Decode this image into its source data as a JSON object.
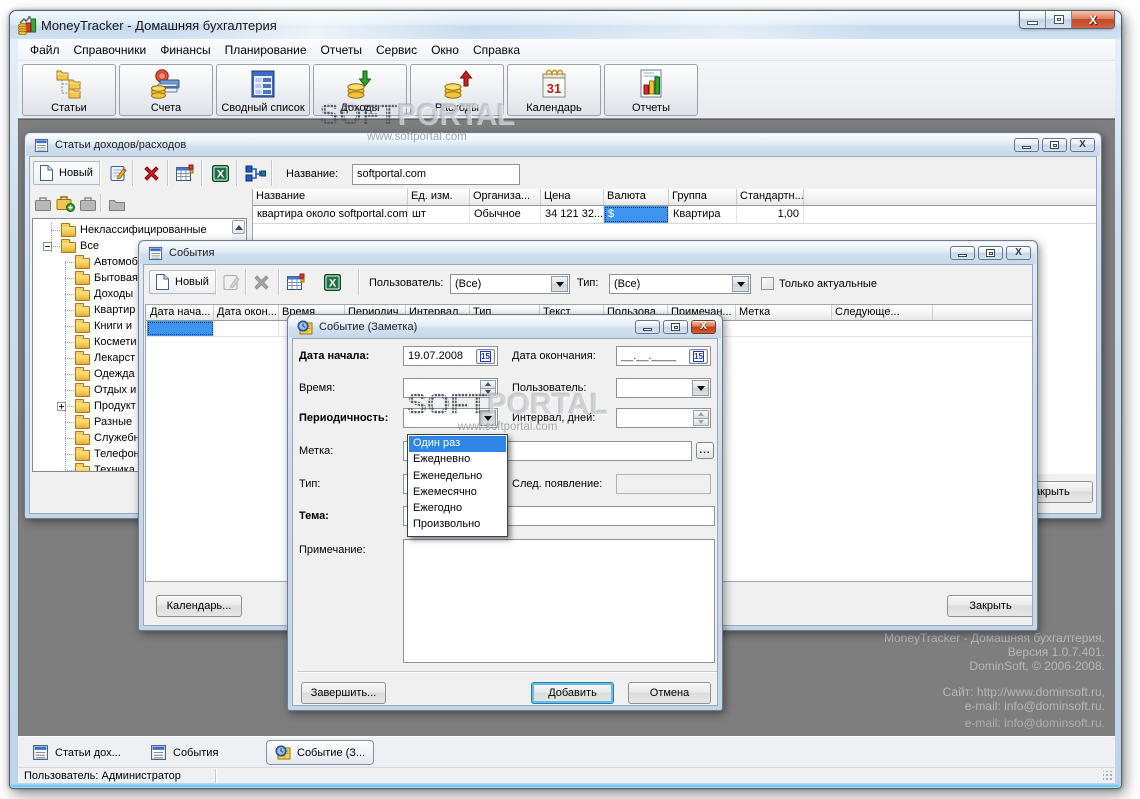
{
  "main_window": {
    "title": "MoneyTracker - Домашняя бухгалтерия",
    "menu_items": [
      "Файл",
      "Справочники",
      "Финансы",
      "Планирование",
      "Отчеты",
      "Сервис",
      "Окно",
      "Справка"
    ],
    "toolbar_buttons": [
      "Статьи",
      "Счета",
      "Сводный список",
      "Доходы",
      "Расходы",
      "Календарь",
      "Отчеты"
    ],
    "taskbar_tabs": [
      "Статьи дох...",
      "События",
      "Событие (З..."
    ],
    "status_user": "Пользователь: Администратор"
  },
  "watermark": {
    "soft": "SOFT",
    "portal": "PORTAL",
    "url": "www.softportal.com"
  },
  "about_text": {
    "line1": "MoneyTracker - Домашняя бухгалтерия.",
    "line2": "Версия 1.0.7.401.",
    "line3": "DominSoft, © 2006-2008.",
    "line4": "Сайт: http://www.dominsoft.ru,",
    "line5": "e-mail: info@dominsoft.ru.",
    "line6": "e-mail: info@dominsoft.ru."
  },
  "articles_window": {
    "title": "Статьи доходов/расходов",
    "new_button": "Новый",
    "name_label": "Название:",
    "name_value": "softportal.com",
    "close_button": "Закрыть",
    "tree_items": [
      {
        "label": "Неклассифицированные",
        "level": 1,
        "expand": "none"
      },
      {
        "label": "Все",
        "level": 1,
        "expand": "minus"
      },
      {
        "label": "Автомоб",
        "level": 2,
        "expand": "none"
      },
      {
        "label": "Бытовая",
        "level": 2,
        "expand": "none"
      },
      {
        "label": "Доходы",
        "level": 2,
        "expand": "none"
      },
      {
        "label": "Квартир",
        "level": 2,
        "expand": "none"
      },
      {
        "label": "Книги и",
        "level": 2,
        "expand": "none"
      },
      {
        "label": "Космети",
        "level": 2,
        "expand": "none"
      },
      {
        "label": "Лекарст",
        "level": 2,
        "expand": "none"
      },
      {
        "label": "Одежда",
        "level": 2,
        "expand": "none"
      },
      {
        "label": "Отдых и",
        "level": 2,
        "expand": "none"
      },
      {
        "label": "Продукт",
        "level": 2,
        "expand": "plus"
      },
      {
        "label": "Разные",
        "level": 2,
        "expand": "none"
      },
      {
        "label": "Служебн",
        "level": 2,
        "expand": "none"
      },
      {
        "label": "Телефон",
        "level": 2,
        "expand": "none"
      },
      {
        "label": "Техника",
        "level": 2,
        "expand": "none"
      }
    ],
    "table_headers": [
      "Название",
      "Ед. изм.",
      "Организа...",
      "Цена",
      "Валюта",
      "Группа",
      "Стандартн..."
    ],
    "table_row": {
      "name": "квартира около softportal.com",
      "unit": "шт",
      "org": "Обычное",
      "price": "34 121 32...",
      "currency": "$",
      "group": "Квартира",
      "standard": "1,00"
    }
  },
  "events_window": {
    "title": "События",
    "new_button": "Новый",
    "user_label": "Пользователь:",
    "user_value": "(Все)",
    "type_label": "Тип:",
    "type_value": "(Все)",
    "actual_checkbox": "Только актуальные",
    "table_headers": [
      "Дата нача...",
      "Дата окон...",
      "Время",
      "Периодич...",
      "Интервал...",
      "Тип",
      "Текст",
      "Пользова...",
      "Примечан...",
      "Метка",
      "Следующе..."
    ],
    "calendar_button": "Календарь...",
    "close_button": "Закрыть"
  },
  "event_dialog": {
    "title": "Событие (Заметка)",
    "labels": {
      "start_date": "Дата начала:",
      "end_date": "Дата окончания:",
      "time": "Время:",
      "user": "Пользователь:",
      "periodicity": "Периодичность:",
      "interval": "Интервал, дней:",
      "mark": "Метка:",
      "type": "Тип:",
      "next": "След. появление:",
      "subject": "Тема:",
      "note": "Примечание:"
    },
    "values": {
      "start_date": "19.07.2008",
      "end_date": "__.__.____",
      "calendar_day": "15"
    },
    "dropdown_items": [
      "Один раз",
      "Ежедневно",
      "Еженедельно",
      "Ежемесячно",
      "Ежегодно",
      "Произвольно"
    ],
    "buttons": {
      "finish": "Завершить...",
      "add": "Добавить",
      "cancel": "Отмена",
      "browse": "..."
    }
  }
}
